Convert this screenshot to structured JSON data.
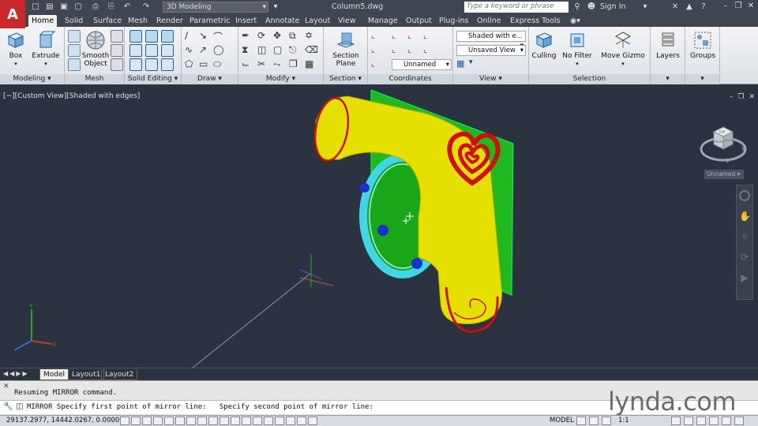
{
  "titlebar": {
    "logo_letter": "A",
    "workspace": "3D Modeling",
    "document": "Column5.dwg",
    "search_placeholder": "Type a keyword or phrase",
    "sign_in": "Sign In"
  },
  "ribbon_tabs": [
    "Home",
    "Solid",
    "Surface",
    "Mesh",
    "Render",
    "Parametric",
    "Insert",
    "Annotate",
    "Layout",
    "View",
    "Manage",
    "Output",
    "Plug-ins",
    "Online",
    "Express Tools"
  ],
  "ribbon": {
    "modeling": {
      "label": "Modeling",
      "box": "Box",
      "extrude": "Extrude"
    },
    "mesh": {
      "label": "Mesh",
      "smooth": "Smooth Object"
    },
    "solid_editing": {
      "label": "Solid Editing"
    },
    "draw": {
      "label": "Draw"
    },
    "modify": {
      "label": "Modify"
    },
    "section": {
      "label": "Section",
      "plane": "Section Plane"
    },
    "coordinates": {
      "label": "Coordinates",
      "ucs": "Unnamed"
    },
    "view": {
      "label": "View",
      "visual_style": "Shaded with e...",
      "saved_view": "Unsaved View"
    },
    "selection": {
      "label": "Selection",
      "culling": "Culling",
      "no_filter": "No Filter",
      "move_gizmo": "Move Gizmo"
    },
    "layers": {
      "label": "Layers"
    },
    "groups": {
      "label": "Groups"
    }
  },
  "viewport": {
    "label": "[−][Custom View][Shaded with edges]",
    "viewcube_top": "TOP",
    "viewcube_front": "FRONT",
    "viewcube_right": "RIGHT",
    "compass_e": "E",
    "compass_s": "S",
    "ucs_tag": "Unnamed"
  },
  "layout_tabs": [
    "Model",
    "Layout1",
    "Layout2"
  ],
  "command": {
    "history": "Resuming MIRROR command.",
    "current": "MIRROR Specify first point of mirror line:   Specify second point of mirror line:"
  },
  "status": {
    "coords": "29137.2977, 14442.0267, 0.0000",
    "model": "MODEL",
    "scale": "1:1"
  },
  "watermark": "lynda.com",
  "colors": {
    "accent": "#c8282a",
    "object_yellow": "#e6e000",
    "edge_red": "#d01010",
    "plate_green": "#1fb81f",
    "ring_cyan": "#3fd6e8"
  }
}
